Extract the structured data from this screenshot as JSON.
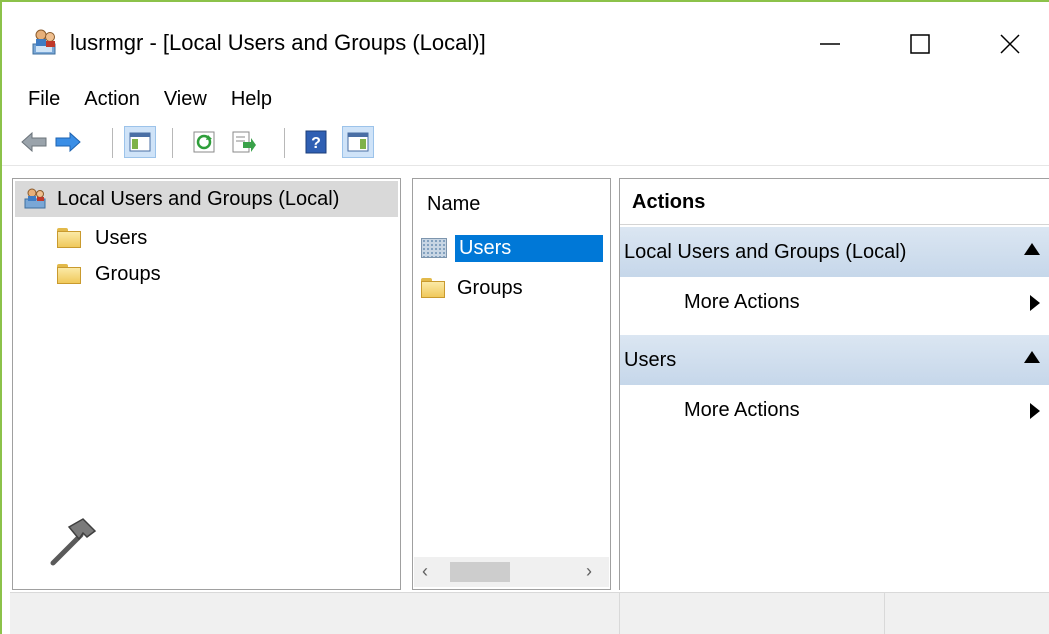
{
  "window": {
    "title": "lusrmgr - [Local Users and Groups (Local)]",
    "icon": "users-computer-icon",
    "controls": {
      "minimize": "minimize-icon",
      "maximize": "maximize-icon",
      "close": "close-icon"
    }
  },
  "menu": {
    "items": [
      {
        "label": "File"
      },
      {
        "label": "Action"
      },
      {
        "label": "View"
      },
      {
        "label": "Help"
      }
    ]
  },
  "toolbar": {
    "buttons": [
      "back-arrow-icon",
      "forward-arrow-icon",
      "show-hide-console-tree-icon",
      "refresh-icon",
      "export-list-icon",
      "help-icon",
      "show-hide-action-pane-icon"
    ]
  },
  "tree": {
    "root": {
      "label": "Local Users and Groups (Local)"
    },
    "children": [
      {
        "label": "Users"
      },
      {
        "label": "Groups"
      }
    ]
  },
  "list": {
    "column": "Name",
    "rows": [
      {
        "label": "Users",
        "selected": true
      },
      {
        "label": "Groups",
        "selected": false
      }
    ],
    "scroll_left": "‹",
    "scroll_right": "›"
  },
  "actions": {
    "title": "Actions",
    "sections": [
      {
        "header": "Local Users and Groups (Local)",
        "item": "More Actions"
      },
      {
        "header": "Users",
        "item": "More Actions"
      }
    ]
  },
  "colors": {
    "selection": "#0078d7",
    "accent_border": "#8cc24a",
    "action_header": "#c6d7ea"
  }
}
